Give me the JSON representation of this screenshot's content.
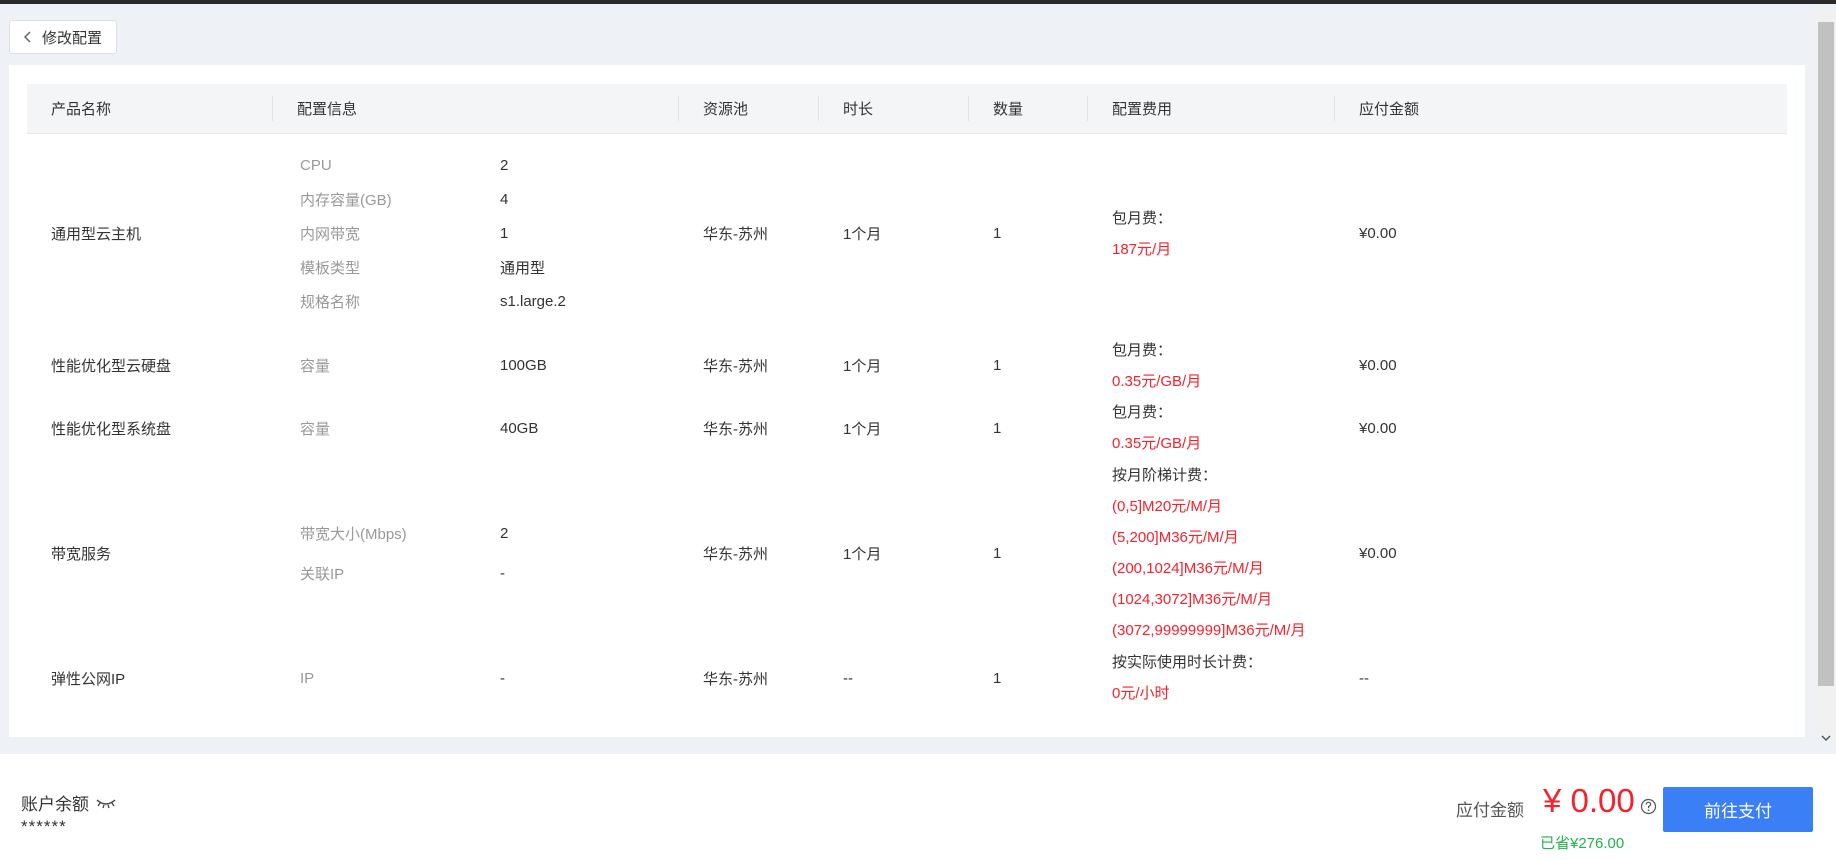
{
  "back_button": {
    "label": "修改配置"
  },
  "table": {
    "columns": [
      "产品名称",
      "配置信息",
      "资源池",
      "时长",
      "数量",
      "配置费用",
      "应付金额"
    ],
    "rows": [
      {
        "product": "通用型云主机",
        "config": [
          {
            "k": "CPU",
            "v": "2"
          },
          {
            "k": "内存容量(GB)",
            "v": "4"
          },
          {
            "k": "内网带宽",
            "v": "1"
          },
          {
            "k": "模板类型",
            "v": "通用型"
          },
          {
            "k": "规格名称",
            "v": "s1.large.2"
          }
        ],
        "pool": "华东-苏州",
        "duration": "1个月",
        "quantity": "1",
        "fee_label": "包月费：",
        "fee_lines": [
          "187元/月"
        ],
        "amount": "¥0.00"
      },
      {
        "product": "性能优化型云硬盘",
        "config": [
          {
            "k": "容量",
            "v": "100GB"
          }
        ],
        "pool": "华东-苏州",
        "duration": "1个月",
        "quantity": "1",
        "fee_label": "包月费：",
        "fee_lines": [
          "0.35元/GB/月"
        ],
        "amount": "¥0.00"
      },
      {
        "product": "性能优化型系统盘",
        "config": [
          {
            "k": "容量",
            "v": "40GB"
          }
        ],
        "pool": "华东-苏州",
        "duration": "1个月",
        "quantity": "1",
        "fee_label": "包月费：",
        "fee_lines": [
          "0.35元/GB/月"
        ],
        "amount": "¥0.00"
      },
      {
        "product": "带宽服务",
        "config": [
          {
            "k": "带宽大小(Mbps)",
            "v": "2"
          },
          {
            "k": "关联IP",
            "v": "-"
          }
        ],
        "pool": "华东-苏州",
        "duration": "1个月",
        "quantity": "1",
        "fee_label": "按月阶梯计费：",
        "fee_lines": [
          "(0,5]M20元/M/月",
          "(5,200]M36元/M/月",
          "(200,1024]M36元/M/月",
          "(1024,3072]M36元/M/月",
          "(3072,99999999]M36元/M/月"
        ],
        "amount": "¥0.00"
      },
      {
        "product": "弹性公网IP",
        "config": [
          {
            "k": "IP",
            "v": "-"
          }
        ],
        "pool": "华东-苏州",
        "duration": "--",
        "quantity": "1",
        "fee_label": "按实际使用时长计费：",
        "fee_lines": [
          "0元/小时"
        ],
        "amount": "--"
      }
    ]
  },
  "footer": {
    "balance_label": "账户余额",
    "balance_value": "******",
    "pay_label": "应付金额",
    "pay_amount": "¥ 0.00",
    "saved": "已省¥276.00",
    "pay_button": "前往支付"
  },
  "colors": {
    "accent": "#3a7ff6",
    "price_red": "#f5222d",
    "saved_green": "#22b14c"
  },
  "icons": {
    "back": "chevron-left-icon",
    "eye": "eye-closed-icon",
    "help": "question-circle-icon"
  }
}
